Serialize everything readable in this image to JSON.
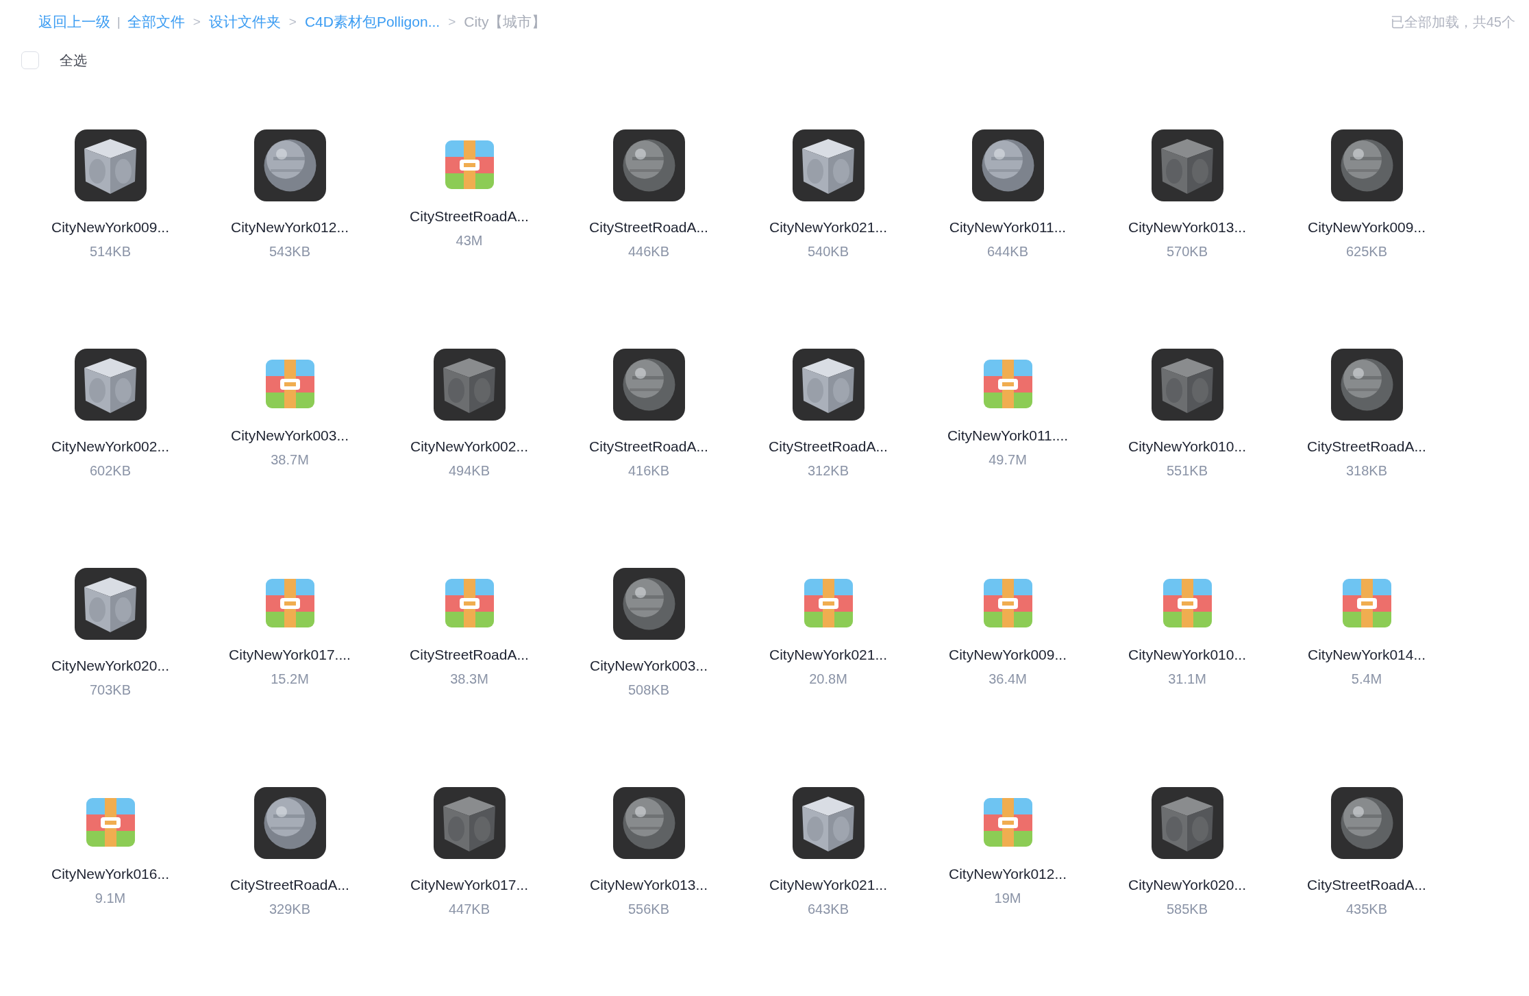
{
  "breadcrumb": [
    {
      "kind": "link",
      "text": "返回上一级"
    },
    {
      "kind": "divider",
      "text": "|"
    },
    {
      "kind": "link",
      "text": "全部文件"
    },
    {
      "kind": "separator",
      "text": ">"
    },
    {
      "kind": "link",
      "text": "设计文件夹"
    },
    {
      "kind": "separator",
      "text": ">"
    },
    {
      "kind": "link",
      "text": "C4D素材包Polligon..."
    },
    {
      "kind": "separator",
      "text": ">"
    },
    {
      "kind": "current",
      "text": "City【城市】"
    }
  ],
  "load_status": "已全部加载，共45个",
  "select_all": {
    "label": "全选",
    "checked": false
  },
  "files": [
    {
      "name": "CityNewYork009...",
      "size": "514KB"
    },
    {
      "name": "CityNewYork012...",
      "size": "543KB"
    },
    {
      "kind": "archive",
      "name": "CityStreetRoadA...",
      "size": "43M"
    },
    {
      "name": "CityStreetRoadA...",
      "size": "446KB"
    },
    {
      "name": "CityNewYork021...",
      "size": "540KB"
    },
    {
      "name": "CityNewYork011...",
      "size": "644KB"
    },
    {
      "name": "CityNewYork013...",
      "size": "570KB"
    },
    {
      "name": "CityNewYork009...",
      "size": "625KB"
    },
    {
      "name": "CityNewYork002...",
      "size": "602KB"
    },
    {
      "kind": "archive",
      "name": "CityNewYork003...",
      "size": "38.7M"
    },
    {
      "name": "CityNewYork002...",
      "size": "494KB"
    },
    {
      "name": "CityStreetRoadA...",
      "size": "416KB"
    },
    {
      "name": "CityStreetRoadA...",
      "size": "312KB"
    },
    {
      "kind": "archive",
      "name": "CityNewYork011....",
      "size": "49.7M"
    },
    {
      "name": "CityNewYork010...",
      "size": "551KB"
    },
    {
      "name": "CityStreetRoadA...",
      "size": "318KB"
    },
    {
      "name": "CityNewYork020...",
      "size": "703KB"
    },
    {
      "kind": "archive",
      "name": "CityNewYork017....",
      "size": "15.2M"
    },
    {
      "kind": "archive",
      "name": "CityStreetRoadA...",
      "size": "38.3M"
    },
    {
      "name": "CityNewYork003...",
      "size": "508KB"
    },
    {
      "kind": "archive",
      "name": "CityNewYork021...",
      "size": "20.8M"
    },
    {
      "kind": "archive",
      "name": "CityNewYork009...",
      "size": "36.4M"
    },
    {
      "kind": "archive",
      "name": "CityNewYork010...",
      "size": "31.1M"
    },
    {
      "kind": "archive",
      "name": "CityNewYork014...",
      "size": "5.4M"
    },
    {
      "kind": "archive",
      "name": "CityNewYork016...",
      "size": "9.1M"
    },
    {
      "name": "CityStreetRoadA...",
      "size": "329KB"
    },
    {
      "name": "CityNewYork017...",
      "size": "447KB"
    },
    {
      "name": "CityNewYork013...",
      "size": "556KB"
    },
    {
      "name": "CityNewYork021...",
      "size": "643KB"
    },
    {
      "kind": "archive",
      "name": "CityNewYork012...",
      "size": "19M"
    },
    {
      "name": "CityNewYork020...",
      "size": "585KB"
    },
    {
      "name": "CityStreetRoadA...",
      "size": "435KB"
    }
  ]
}
